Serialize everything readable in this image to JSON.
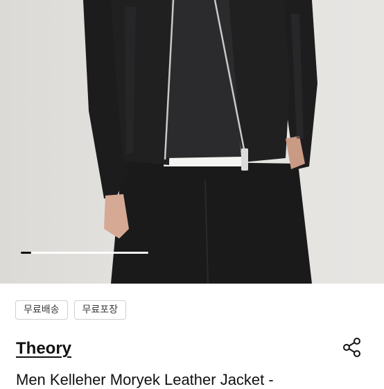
{
  "product": {
    "brand": "Theory",
    "name": "Men Kelleher Moryek Leather Jacket -",
    "image_alt": "Theory leather jacket product photo"
  },
  "gallery": {
    "current_index": 1,
    "progress_fraction": 0.08
  },
  "tags": [
    {
      "label": "무료배송"
    },
    {
      "label": "무료포장"
    }
  ],
  "icons": {
    "share": "share-icon"
  },
  "colors": {
    "accent": "#111111",
    "tag_border": "#cfcfcf",
    "photo_bg": "#e4e2df"
  }
}
